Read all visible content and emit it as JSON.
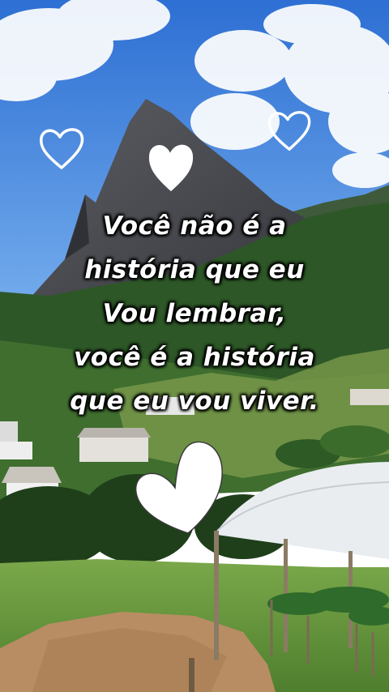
{
  "quote": {
    "lines": [
      "Você não é a",
      "história que eu",
      "Vou lembrar,",
      "você é a história",
      "que eu vou viver."
    ]
  },
  "colors": {
    "sky_top": "#2f74d6",
    "sky_bottom": "#6aa7ee",
    "mountain": "#4a4c52",
    "forest": "#2f5a2a",
    "grass": "#6f9f3e",
    "dirt": "#b58a62",
    "greenhouse": "#e9ecef",
    "text": "#ffffff"
  },
  "icons": [
    "heart-outline-icon",
    "heart-filled-icon"
  ]
}
